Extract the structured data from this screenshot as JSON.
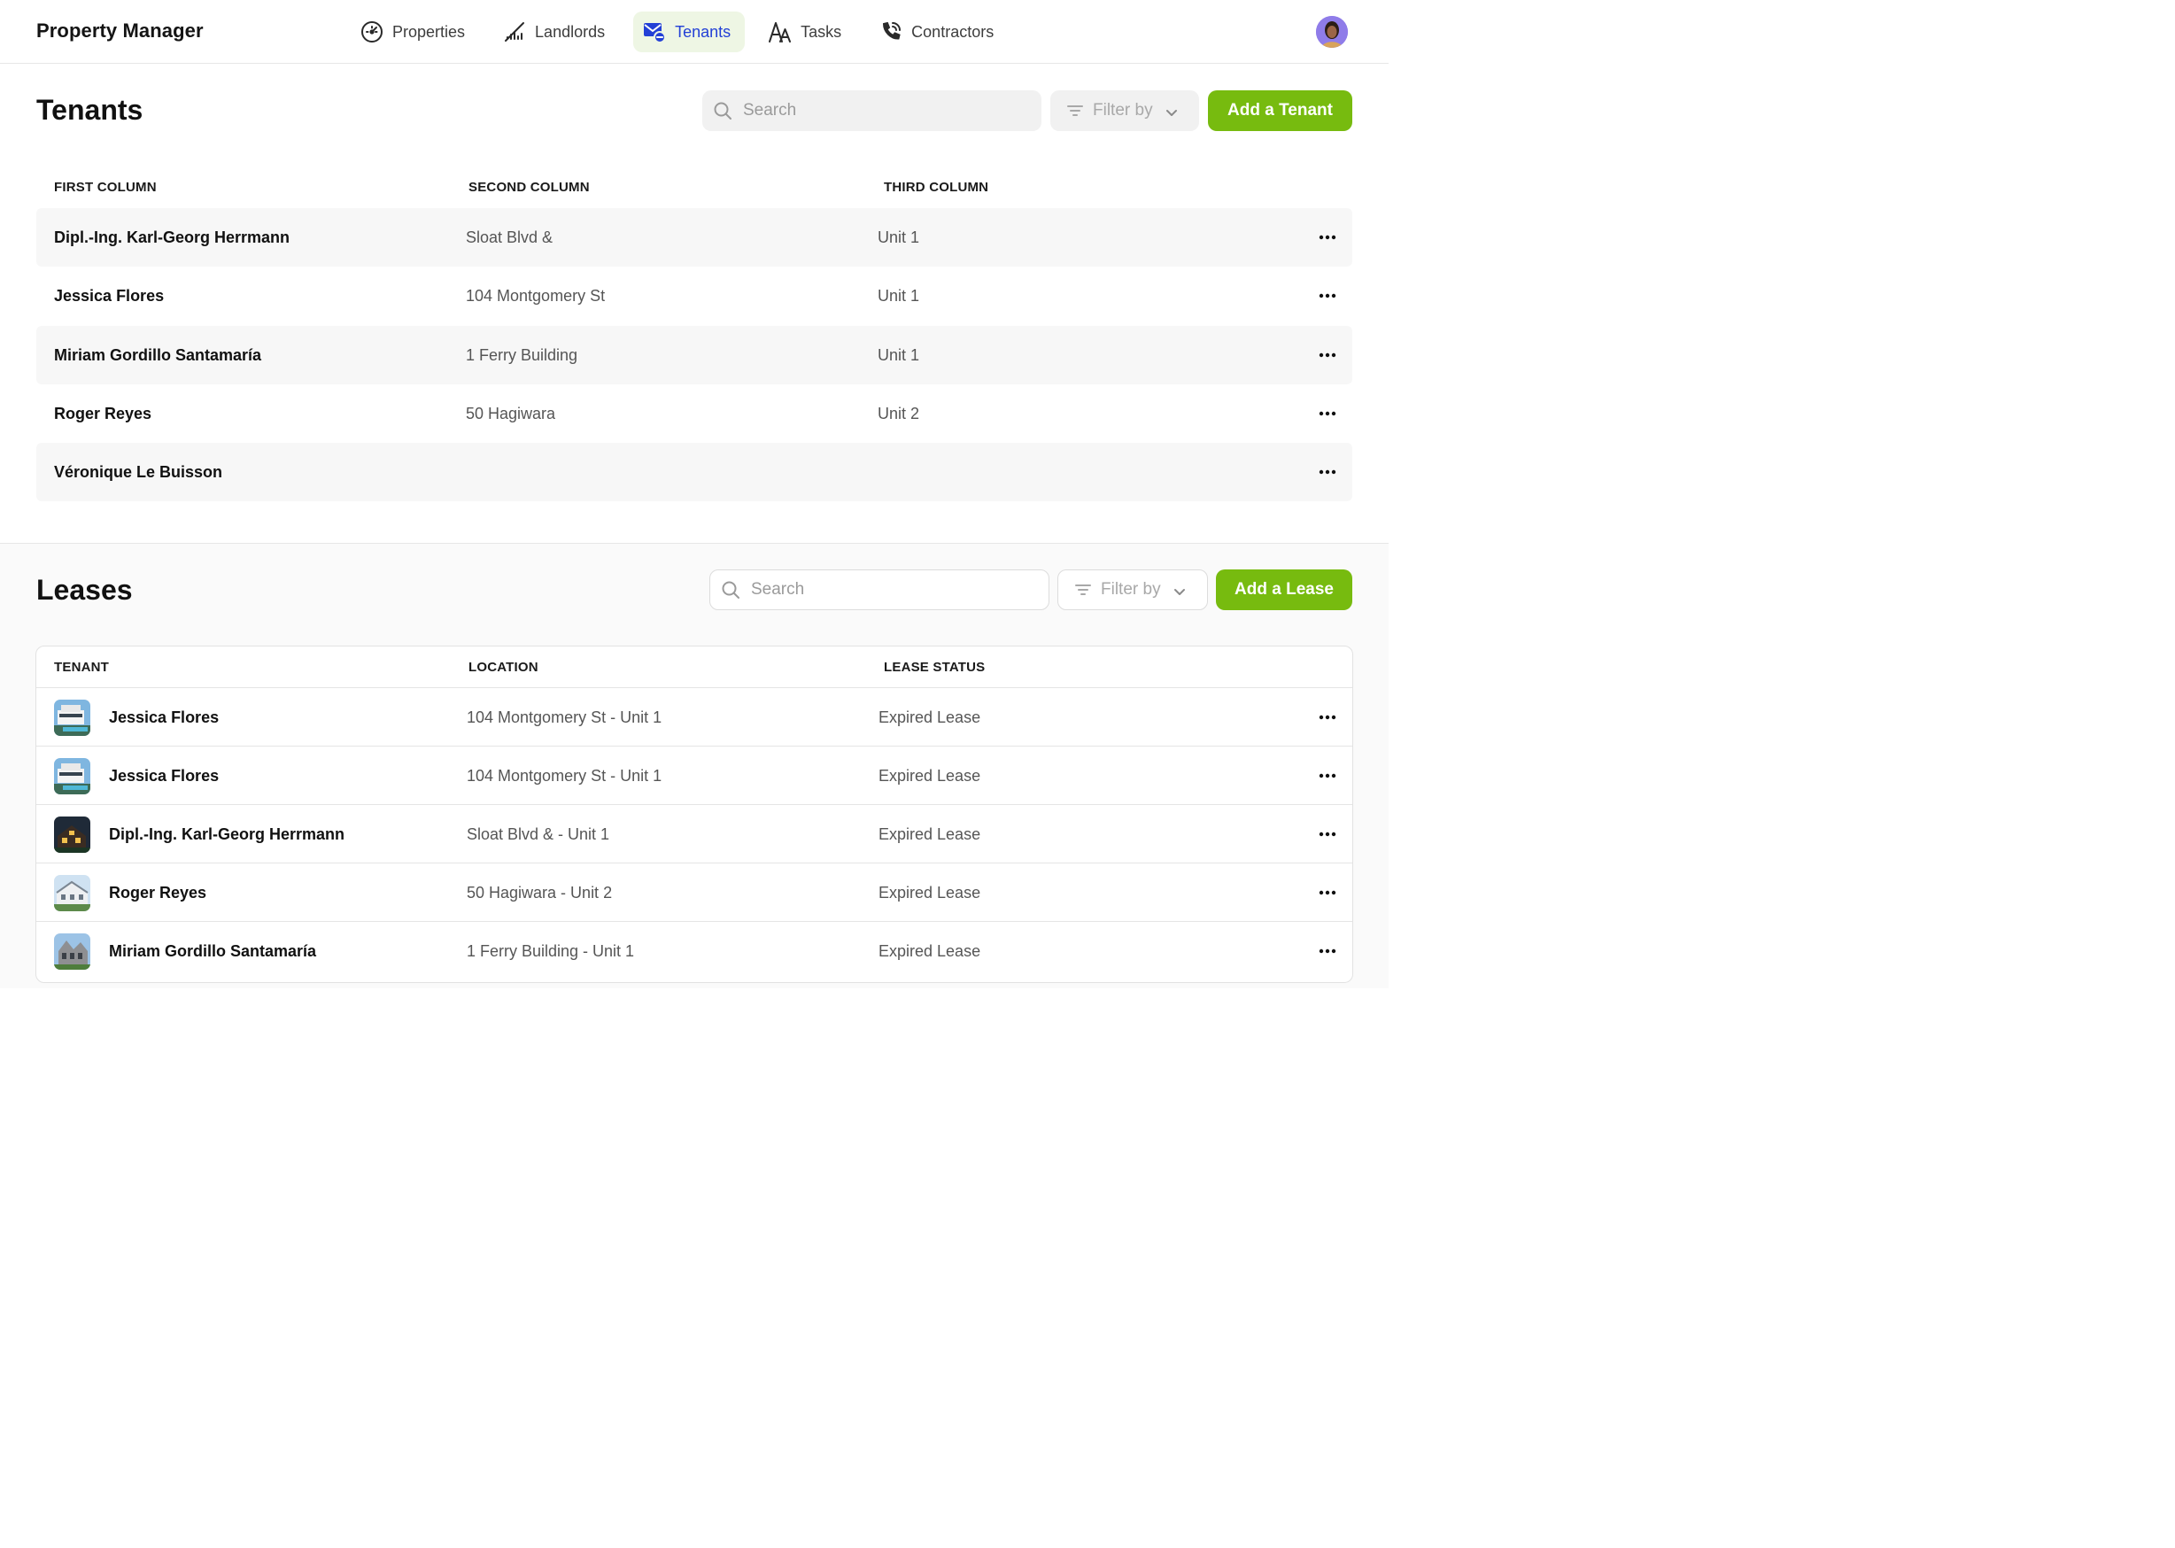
{
  "app": {
    "title": "Property Manager"
  },
  "nav": {
    "items": [
      {
        "label": "Properties",
        "icon": "speedometer-icon"
      },
      {
        "label": "Landlords",
        "icon": "signal-slash-icon"
      },
      {
        "label": "Tenants",
        "icon": "mail-minus-icon",
        "active": true
      },
      {
        "label": "Tasks",
        "icon": "font-size-icon"
      },
      {
        "label": "Contractors",
        "icon": "phone-ringing-icon"
      }
    ]
  },
  "colors": {
    "accent": "#77bb0f",
    "active_nav_bg": "#eef6e4",
    "active_nav_text": "#2340d6"
  },
  "tenants": {
    "title": "Tenants",
    "search_placeholder": "Search",
    "filter_label": "Filter by",
    "add_label": "Add a Tenant",
    "columns": [
      "FIRST COLUMN",
      "SECOND COLUMN",
      "THIRD COLUMN"
    ],
    "rows": [
      {
        "name": "Dipl.-Ing. Karl-Georg Herrmann",
        "address": "Sloat Blvd &",
        "unit": "Unit 1"
      },
      {
        "name": "Jessica Flores",
        "address": "104 Montgomery St",
        "unit": "Unit 1"
      },
      {
        "name": "Miriam Gordillo Santamaría",
        "address": "1 Ferry Building",
        "unit": "Unit 1"
      },
      {
        "name": "Roger Reyes",
        "address": "50 Hagiwara",
        "unit": "Unit 2"
      },
      {
        "name": "Véronique Le Buisson",
        "address": "",
        "unit": ""
      }
    ]
  },
  "leases": {
    "title": "Leases",
    "search_placeholder": "Search",
    "filter_label": "Filter by",
    "add_label": "Add a Lease",
    "columns": [
      "TENANT",
      "LOCATION",
      "LEASE STATUS"
    ],
    "rows": [
      {
        "tenant": "Jessica Flores",
        "location": "104 Montgomery St - Unit 1",
        "status": "Expired Lease"
      },
      {
        "tenant": "Jessica Flores",
        "location": "104 Montgomery St - Unit 1",
        "status": "Expired Lease"
      },
      {
        "tenant": "Dipl.-Ing. Karl-Georg Herrmann",
        "location": "Sloat Blvd & - Unit 1",
        "status": "Expired Lease"
      },
      {
        "tenant": "Roger Reyes",
        "location": "50 Hagiwara - Unit 2",
        "status": "Expired Lease"
      },
      {
        "tenant": "Miriam Gordillo Santamaría",
        "location": "1 Ferry Building - Unit 1",
        "status": "Expired Lease"
      }
    ]
  }
}
